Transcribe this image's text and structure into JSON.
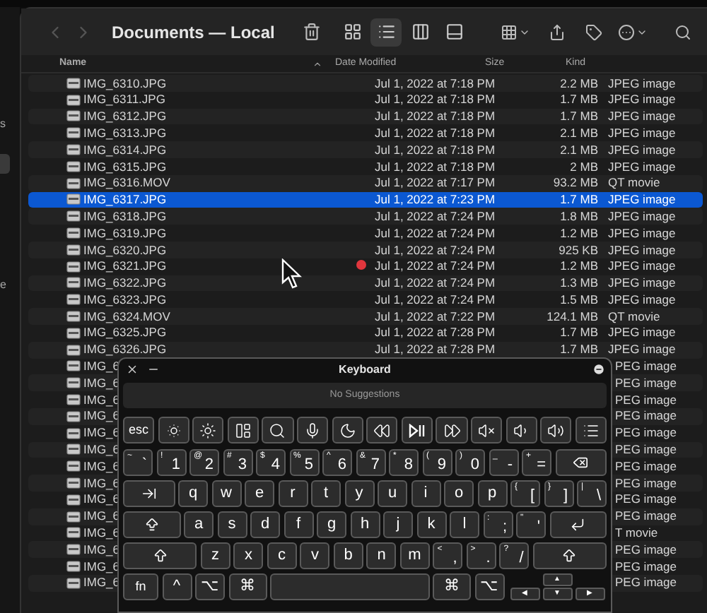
{
  "sidebar": {
    "items": [
      {
        "label": "s"
      },
      {
        "label": "e"
      }
    ]
  },
  "toolbar": {
    "nav": [
      {
        "kind": "back",
        "disabled": true
      },
      {
        "kind": "forward",
        "disabled": true
      }
    ],
    "title": "Documents — Local",
    "view_modes": [
      {
        "selected": false
      },
      {
        "selected": true
      },
      {
        "selected": false
      },
      {
        "selected": false
      }
    ]
  },
  "table": {
    "columns": [
      "Name",
      "Date Modified",
      "Size",
      "Kind"
    ],
    "rows": [
      {
        "name": "IMG_6310.JPG",
        "date": "Jul 1, 2022 at 7:18 PM",
        "size": "2.2 MB",
        "kind": "JPEG image",
        "selected": false
      },
      {
        "name": "IMG_6311.JPG",
        "date": "Jul 1, 2022 at 7:18 PM",
        "size": "1.7 MB",
        "kind": "JPEG image",
        "selected": false
      },
      {
        "name": "IMG_6312.JPG",
        "date": "Jul 1, 2022 at 7:18 PM",
        "size": "1.7 MB",
        "kind": "JPEG image",
        "selected": false
      },
      {
        "name": "IMG_6313.JPG",
        "date": "Jul 1, 2022 at 7:18 PM",
        "size": "2.1 MB",
        "kind": "JPEG image",
        "selected": false
      },
      {
        "name": "IMG_6314.JPG",
        "date": "Jul 1, 2022 at 7:18 PM",
        "size": "2.1 MB",
        "kind": "JPEG image",
        "selected": false
      },
      {
        "name": "IMG_6315.JPG",
        "date": "Jul 1, 2022 at 7:18 PM",
        "size": "2 MB",
        "kind": "JPEG image",
        "selected": false
      },
      {
        "name": "IMG_6316.MOV",
        "date": "Jul 1, 2022 at 7:17 PM",
        "size": "93.2 MB",
        "kind": "QT movie",
        "selected": false
      },
      {
        "name": "IMG_6317.JPG",
        "date": "Jul 1, 2022 at 7:23 PM",
        "size": "1.7 MB",
        "kind": "JPEG image",
        "selected": true
      },
      {
        "name": "IMG_6318.JPG",
        "date": "Jul 1, 2022 at 7:24 PM",
        "size": "1.8 MB",
        "kind": "JPEG image",
        "selected": false
      },
      {
        "name": "IMG_6319.JPG",
        "date": "Jul 1, 2022 at 7:24 PM",
        "size": "1.2 MB",
        "kind": "JPEG image",
        "selected": false
      },
      {
        "name": "IMG_6320.JPG",
        "date": "Jul 1, 2022 at 7:24 PM",
        "size": "925 KB",
        "kind": "JPEG image",
        "selected": false
      },
      {
        "name": "IMG_6321.JPG",
        "date": "Jul 1, 2022 at 7:24 PM",
        "size": "1.2 MB",
        "kind": "JPEG image",
        "selected": false
      },
      {
        "name": "IMG_6322.JPG",
        "date": "Jul 1, 2022 at 7:24 PM",
        "size": "1.3 MB",
        "kind": "JPEG image",
        "selected": false
      },
      {
        "name": "IMG_6323.JPG",
        "date": "Jul 1, 2022 at 7:24 PM",
        "size": "1.5 MB",
        "kind": "JPEG image",
        "selected": false
      },
      {
        "name": "IMG_6324.MOV",
        "date": "Jul 1, 2022 at 7:22 PM",
        "size": "124.1 MB",
        "kind": "QT movie",
        "selected": false
      },
      {
        "name": "IMG_6325.JPG",
        "date": "Jul 1, 2022 at 7:28 PM",
        "size": "1.7 MB",
        "kind": "JPEG image",
        "selected": false
      },
      {
        "name": "IMG_6326.JPG",
        "date": "Jul 1, 2022 at 7:28 PM",
        "size": "1.7 MB",
        "kind": "JPEG image",
        "selected": false
      }
    ],
    "covered_rows": [
      {
        "name": "IMG_6",
        "kind": "PEG image"
      },
      {
        "name": "IMG_6",
        "kind": "PEG image"
      },
      {
        "name": "IMG_6",
        "kind": "PEG image"
      },
      {
        "name": "IMG_6",
        "kind": "PEG image"
      },
      {
        "name": "IMG_6",
        "kind": "PEG image"
      },
      {
        "name": "IMG_6",
        "kind": "PEG image"
      },
      {
        "name": "IMG_6",
        "kind": "PEG image"
      },
      {
        "name": "IMG_6",
        "kind": "PEG image"
      },
      {
        "name": "IMG_6",
        "kind": "PEG image"
      },
      {
        "name": "IMG_6",
        "kind": "PEG image"
      },
      {
        "name": "IMG_6",
        "kind": "T movie"
      },
      {
        "name": "IMG_6",
        "kind": "PEG image"
      },
      {
        "name": "IMG_6",
        "kind": "PEG image"
      },
      {
        "name": "IMG_6",
        "kind": "PEG image"
      }
    ]
  },
  "keyboard": {
    "title": "Keyboard",
    "suggestions": "No Suggestions",
    "rows": [
      {
        "keys": [
          {
            "kind": "text",
            "label": "esc"
          },
          {
            "kind": "icon"
          },
          {
            "kind": "icon"
          },
          {
            "kind": "icon"
          },
          {
            "kind": "icon"
          },
          {
            "kind": "icon"
          },
          {
            "kind": "icon"
          },
          {
            "kind": "icon"
          },
          {
            "kind": "icon"
          },
          {
            "kind": "icon"
          },
          {
            "kind": "icon"
          },
          {
            "kind": "icon"
          },
          {
            "kind": "icon"
          },
          {
            "kind": "icon"
          }
        ]
      },
      {
        "keys": [
          {
            "kind": "char",
            "label": "`",
            "shift": "~"
          },
          {
            "kind": "char",
            "label": "1",
            "shift": "!"
          },
          {
            "kind": "char",
            "label": "2",
            "shift": "@"
          },
          {
            "kind": "char",
            "label": "3",
            "shift": "#"
          },
          {
            "kind": "char",
            "label": "4",
            "shift": "$"
          },
          {
            "kind": "char",
            "label": "5",
            "shift": "%"
          },
          {
            "kind": "char",
            "label": "6",
            "shift": "^"
          },
          {
            "kind": "char",
            "label": "7",
            "shift": "&"
          },
          {
            "kind": "char",
            "label": "8",
            "shift": "*"
          },
          {
            "kind": "char",
            "label": "9",
            "shift": "("
          },
          {
            "kind": "char",
            "label": "0",
            "shift": ")"
          },
          {
            "kind": "char",
            "label": "-",
            "shift": "_"
          },
          {
            "kind": "char",
            "label": "=",
            "shift": "+"
          },
          {
            "kind": "delete"
          }
        ]
      },
      {
        "keys": [
          {
            "kind": "tab"
          },
          {
            "kind": "letter",
            "label": "q"
          },
          {
            "kind": "letter",
            "label": "w"
          },
          {
            "kind": "letter",
            "label": "e"
          },
          {
            "kind": "letter",
            "label": "r"
          },
          {
            "kind": "letter",
            "label": "t"
          },
          {
            "kind": "letter",
            "label": "y"
          },
          {
            "kind": "letter",
            "label": "u"
          },
          {
            "kind": "letter",
            "label": "i"
          },
          {
            "kind": "letter",
            "label": "o"
          },
          {
            "kind": "letter",
            "label": "p"
          },
          {
            "kind": "char",
            "label": "[",
            "shift": "{"
          },
          {
            "kind": "char",
            "label": "]",
            "shift": "}"
          },
          {
            "kind": "char",
            "label": "\\",
            "shift": "|"
          }
        ]
      },
      {
        "keys": [
          {
            "kind": "caps"
          },
          {
            "kind": "letter",
            "label": "a"
          },
          {
            "kind": "letter",
            "label": "s"
          },
          {
            "kind": "letter",
            "label": "d"
          },
          {
            "kind": "letter",
            "label": "f"
          },
          {
            "kind": "letter",
            "label": "g"
          },
          {
            "kind": "letter",
            "label": "h"
          },
          {
            "kind": "letter",
            "label": "j"
          },
          {
            "kind": "letter",
            "label": "k"
          },
          {
            "kind": "letter",
            "label": "l"
          },
          {
            "kind": "char",
            "label": ";",
            "shift": ":"
          },
          {
            "kind": "char",
            "label": "'",
            "shift": "\""
          },
          {
            "kind": "return"
          }
        ]
      },
      {
        "keys": [
          {
            "kind": "shift"
          },
          {
            "kind": "letter",
            "label": "z"
          },
          {
            "kind": "letter",
            "label": "x"
          },
          {
            "kind": "letter",
            "label": "c"
          },
          {
            "kind": "letter",
            "label": "v"
          },
          {
            "kind": "letter",
            "label": "b"
          },
          {
            "kind": "letter",
            "label": "n"
          },
          {
            "kind": "letter",
            "label": "m"
          },
          {
            "kind": "char",
            "label": ",",
            "shift": "<"
          },
          {
            "kind": "char",
            "label": ".",
            "shift": ">"
          },
          {
            "kind": "char",
            "label": "/",
            "shift": "?"
          },
          {
            "kind": "shift"
          }
        ]
      },
      {
        "keys": [
          {
            "kind": "text",
            "label": "fn"
          },
          {
            "kind": "letter",
            "label": "^"
          },
          {
            "kind": "letter",
            "label": "⌥"
          },
          {
            "kind": "wide",
            "label": "⌘"
          },
          {
            "kind": "space"
          },
          {
            "kind": "wide",
            "label": "⌘"
          },
          {
            "kind": "letter",
            "label": "⌥"
          },
          {
            "kind": "arrows",
            "up": "▲",
            "left": "◀",
            "down": "▼",
            "right": "▶"
          }
        ]
      }
    ]
  }
}
